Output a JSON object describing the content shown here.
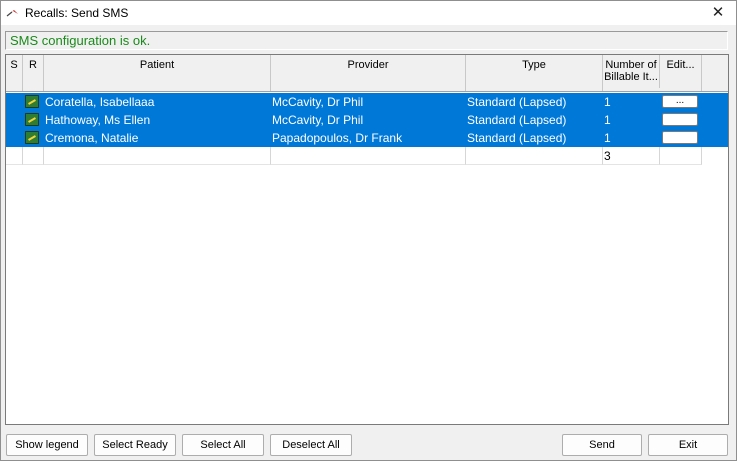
{
  "window": {
    "title": "Recalls: Send SMS",
    "close_glyph": "✕"
  },
  "status": {
    "text": "SMS configuration is ok."
  },
  "table": {
    "headers": {
      "s": "S",
      "r": "R",
      "patient": "Patient",
      "provider": "Provider",
      "type": "Type",
      "billable": "Number of Billable It...",
      "edit": "Edit..."
    },
    "rows": [
      {
        "patient": "Coratella,  Isabellaaa",
        "provider": "McCavity, Dr Phil",
        "type": "Standard (Lapsed)",
        "billable": "1",
        "edit_label": "..."
      },
      {
        "patient": "Hathoway, Ms Ellen",
        "provider": "McCavity, Dr Phil",
        "type": "Standard (Lapsed)",
        "billable": "1",
        "edit_label": ""
      },
      {
        "patient": "Cremona,  Natalie",
        "provider": "Papadopoulos, Dr Frank",
        "type": "Standard (Lapsed)",
        "billable": "1",
        "edit_label": ""
      }
    ],
    "total_billable": "3"
  },
  "buttons": {
    "show_legend": "Show legend",
    "select_ready": "Select Ready",
    "select_all": "Select All",
    "deselect_all": "Deselect All",
    "send": "Send",
    "exit": "Exit"
  },
  "colors": {
    "selection": "#0078d7",
    "status_ok": "#1a8a1a"
  },
  "icons": {
    "app": "recall-app-icon",
    "flag": "ready-flag-icon"
  }
}
